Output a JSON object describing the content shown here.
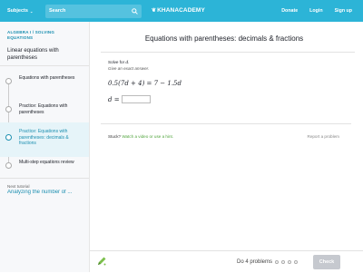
{
  "header": {
    "subjects_label": "Subjects",
    "search_placeholder": "Search",
    "logo_text": "KHANACADEMY",
    "nav": [
      "Donate",
      "Login",
      "Sign up"
    ]
  },
  "sidebar": {
    "breadcrumb": "ALGEBRA I / SOLVING EQUATIONS",
    "topic_title": "Linear equations with parentheses",
    "items": [
      {
        "label": "Equations with parentheses"
      },
      {
        "label": "Practice: Equations with parentheses"
      },
      {
        "label": "Practice: Equations with parentheses: decimals & fractions"
      },
      {
        "label": "Multi-step equations review"
      }
    ],
    "next_label": "Next tutorial",
    "next_link": "Analyzing the number of ..."
  },
  "main": {
    "title": "Equations with parentheses: decimals & fractions",
    "solve_prefix": "Solve for ",
    "solve_var": "d",
    "solve_suffix": ".",
    "exact_note": "Give an exact answer.",
    "equation": "0.5(7d + 4) = 7 − 1.5d",
    "answer_prefix": "d =",
    "stuck_label": "Stuck?",
    "stuck_link": "Watch a video or use a hint.",
    "report_label": "Report a problem"
  },
  "footer": {
    "progress_text": "Do 4 problems",
    "check_label": "Check"
  },
  "colors": {
    "brand": "#2cb4d7",
    "link": "#1c8fb0",
    "hint_green": "#50a43c",
    "check_disabled": "#c6c9cf"
  }
}
